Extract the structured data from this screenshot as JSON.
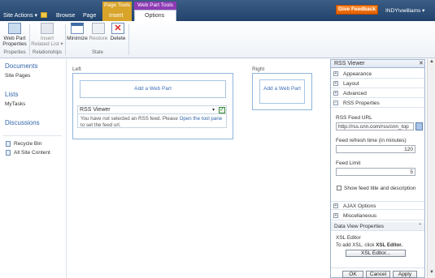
{
  "topbar": {
    "site_actions": "Site Actions ▾",
    "tabs": [
      "Browse",
      "Page",
      "Insert",
      "Options"
    ],
    "ctx_page_tools": "Page Tools",
    "ctx_web_part_tools": "Web Part Tools",
    "feedback": "Give Feedback",
    "user": "INDY\\vwilliams ▾"
  },
  "ribbon": {
    "btn_props": "Web Part Properties",
    "btn_related": "Insert Related List ▾",
    "btn_minimize": "Minimize",
    "btn_restore": "Restore",
    "btn_delete": "Delete",
    "grp_properties": "Properties",
    "grp_relationships": "Relationships",
    "grp_state": "State"
  },
  "nav": {
    "documents": "Documents",
    "site_pages": "Site Pages",
    "lists": "Lists",
    "my_tasks": "MyTasks",
    "discussions": "Discussions",
    "recycle_bin": "Recycle Bin",
    "all_site_content": "All Site Content"
  },
  "zones": {
    "left_label": "Left",
    "right_label": "Right",
    "add_web_part": "Add a Web Part",
    "add_web_part_right": "Add a Web Part"
  },
  "rss_viewer": {
    "title": "RSS Viewer",
    "message": "You have not selected an RSS feed. Please",
    "link": "Open the tool pane",
    "message_end": "to set the feed url."
  },
  "toolpane": {
    "title": "RSS Viewer",
    "sections": [
      "Appearance",
      "Layout",
      "Advanced",
      "RSS Properties"
    ],
    "feed_url_label": "RSS Feed URL",
    "feed_url_value": "http://rss.cnn.com/rss/cnn_top",
    "refresh_label": "Feed refresh time (in minutes)",
    "refresh_value": "120",
    "limit_label": "Feed Limit",
    "limit_value": "5",
    "show_title_label": "Show feed title and description",
    "ajax": "AJAX Options",
    "misc": "Miscellaneous",
    "dv_props": "Data View Properties",
    "xsl_editor_heading": "XSL Editor",
    "xsl_hint_pre": "To add XSL, click",
    "xsl_hint_bold": "XSL Editor.",
    "xsl_button": "XSL Editor...",
    "ok": "OK",
    "cancel": "Cancel",
    "apply": "Apply"
  }
}
